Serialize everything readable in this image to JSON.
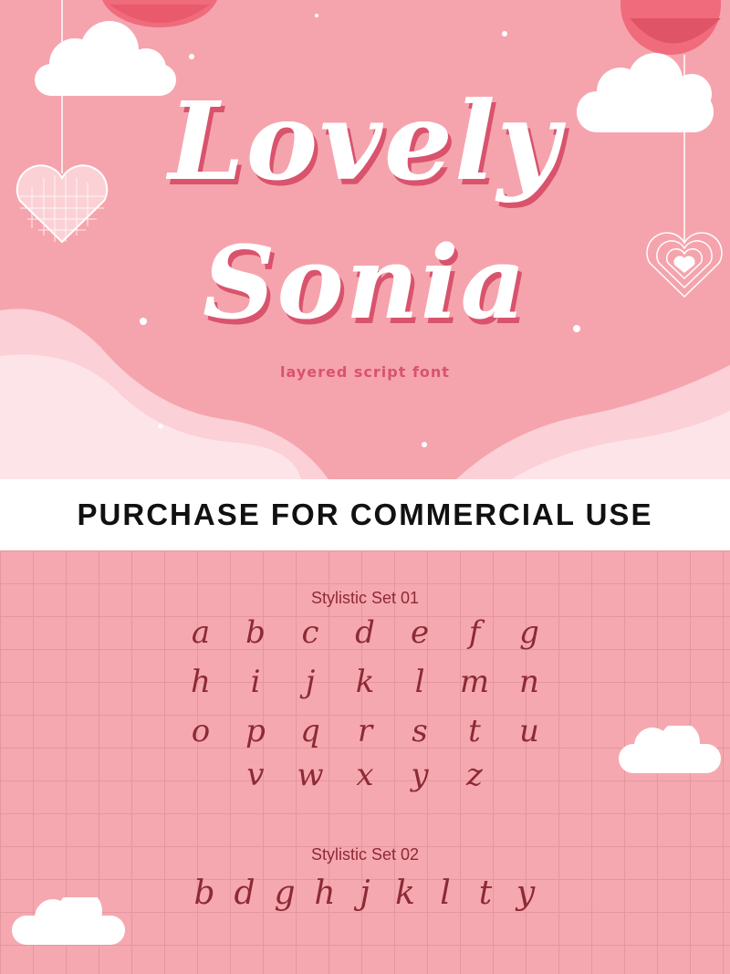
{
  "hero": {
    "title_line1": "Lovely",
    "title_line2": "Sonia",
    "subtitle": "layered script font",
    "colors": {
      "background": "#f5a4ad",
      "title_shadow": "#d9536d",
      "title": "#ffffff"
    }
  },
  "banner": {
    "text": "PURCHASE FOR COMMERCIAL USE"
  },
  "set1": {
    "title": "Stylistic Set 01",
    "rows": [
      [
        "a",
        "b",
        "c",
        "d",
        "e",
        "f",
        "g"
      ],
      [
        "h",
        "i",
        "j",
        "k",
        "l",
        "m",
        "n"
      ],
      [
        "o",
        "p",
        "q",
        "r",
        "s",
        "t",
        "u"
      ],
      [
        "v",
        "w",
        "x",
        "y",
        "z"
      ]
    ]
  },
  "set2": {
    "title": "Stylistic Set 02",
    "glyphs": [
      "b",
      "d",
      "g",
      "h",
      "j",
      "k",
      "l",
      "t",
      "y"
    ]
  },
  "colors": {
    "grid_bg": "#f6a8b0",
    "grid_line": "#e597a0",
    "glyph": "#8c2a35"
  }
}
